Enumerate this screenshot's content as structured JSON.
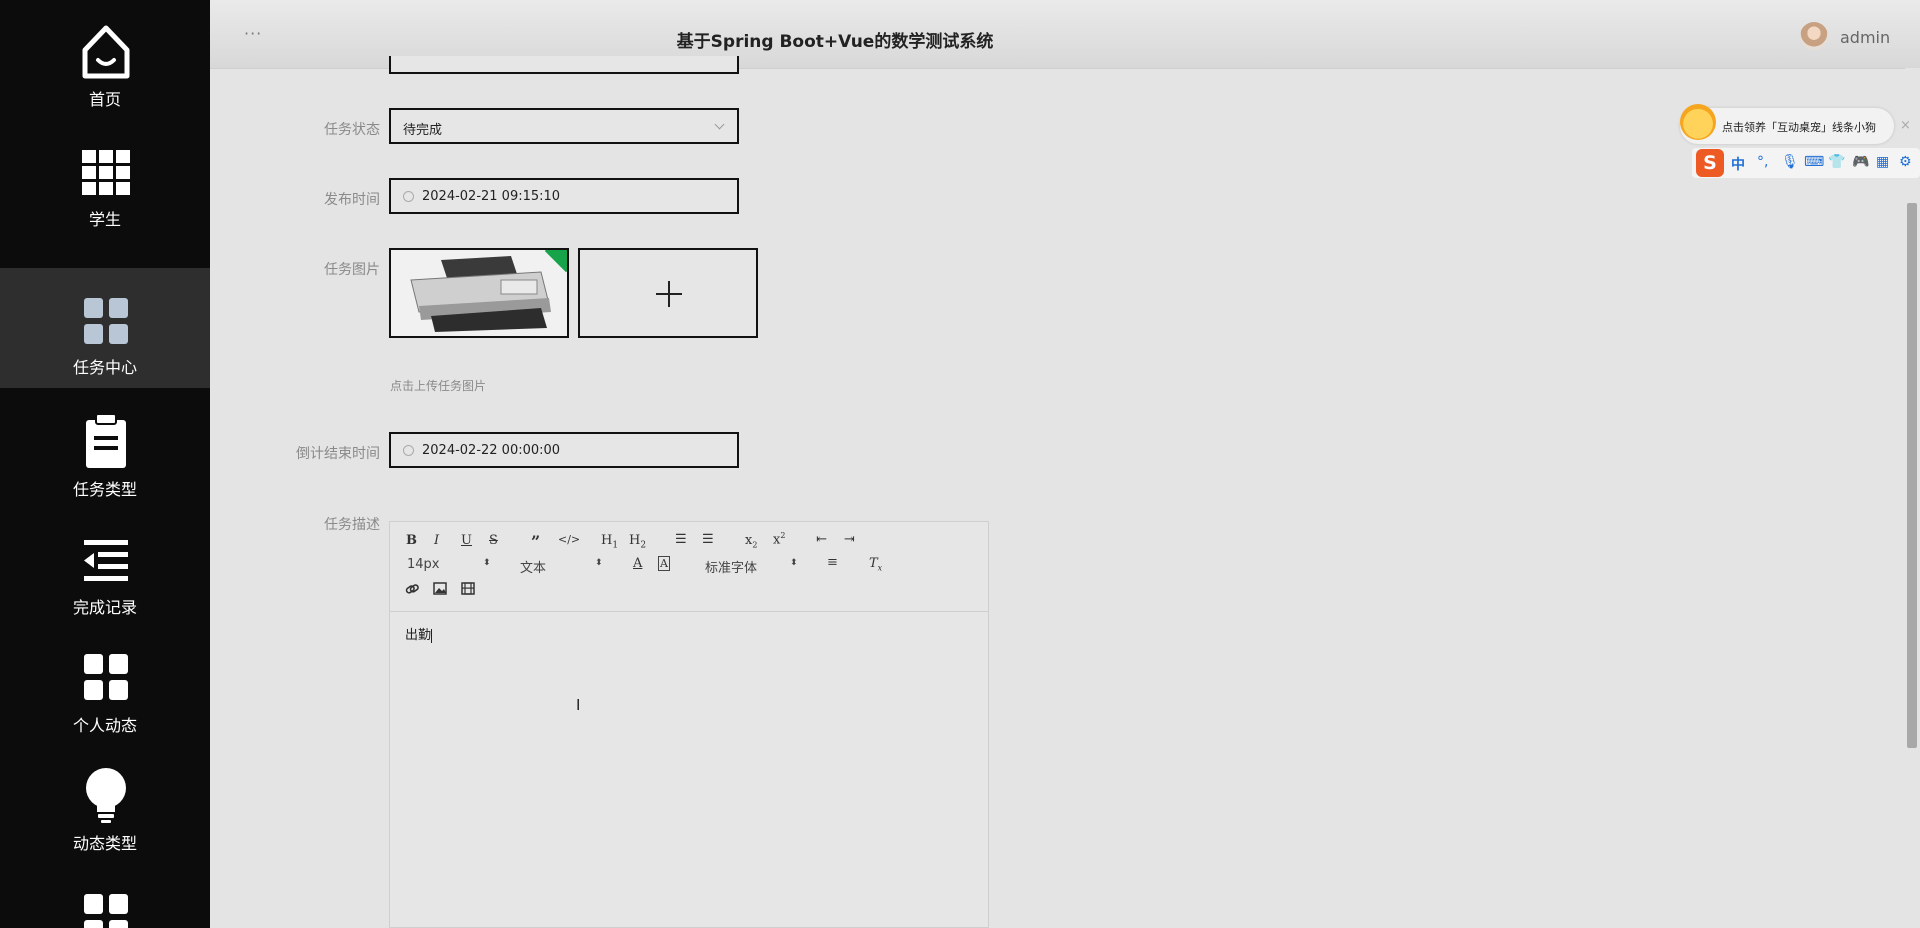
{
  "app": {
    "title": "基于Spring Boot+Vue的数学测试系统",
    "user": "admin",
    "menu_dots": "···"
  },
  "sidebar": {
    "items": [
      {
        "label": "首页",
        "icon": "home-icon"
      },
      {
        "label": "学生",
        "icon": "grid-icon"
      },
      {
        "label": "任务中心",
        "icon": "tiles-icon",
        "active": true
      },
      {
        "label": "任务类型",
        "icon": "clipboard-icon"
      },
      {
        "label": "完成记录",
        "icon": "list-back-icon"
      },
      {
        "label": "个人动态",
        "icon": "tiles-icon"
      },
      {
        "label": "动态类型",
        "icon": "lightbulb-icon"
      }
    ]
  },
  "form": {
    "status_label": "任务状态",
    "status_value": "待完成",
    "publish_label": "发布时间",
    "publish_value": "2024-02-21 09:15:10",
    "image_label": "任务图片",
    "upload_plus": "+",
    "upload_tip": "点击上传任务图片",
    "deadline_label": "倒计结束时间",
    "deadline_value": "2024-02-22 00:00:00",
    "desc_label": "任务描述"
  },
  "editor": {
    "font_size": "14px",
    "block_format": "文本",
    "font_family": "标准字体",
    "content": "出勤"
  },
  "ime": {
    "promo": "点击领养「互动桌宠」线条小狗",
    "lang": "中",
    "punct": "°,",
    "close": "×"
  },
  "colors": {
    "sidebar_bg": "#0c0c0c",
    "sidebar_active": "#2e2e2e",
    "page_bg": "#e4e4e4",
    "icon_blue": "#b8c6d6",
    "ime_accent": "#1f6fd6"
  }
}
